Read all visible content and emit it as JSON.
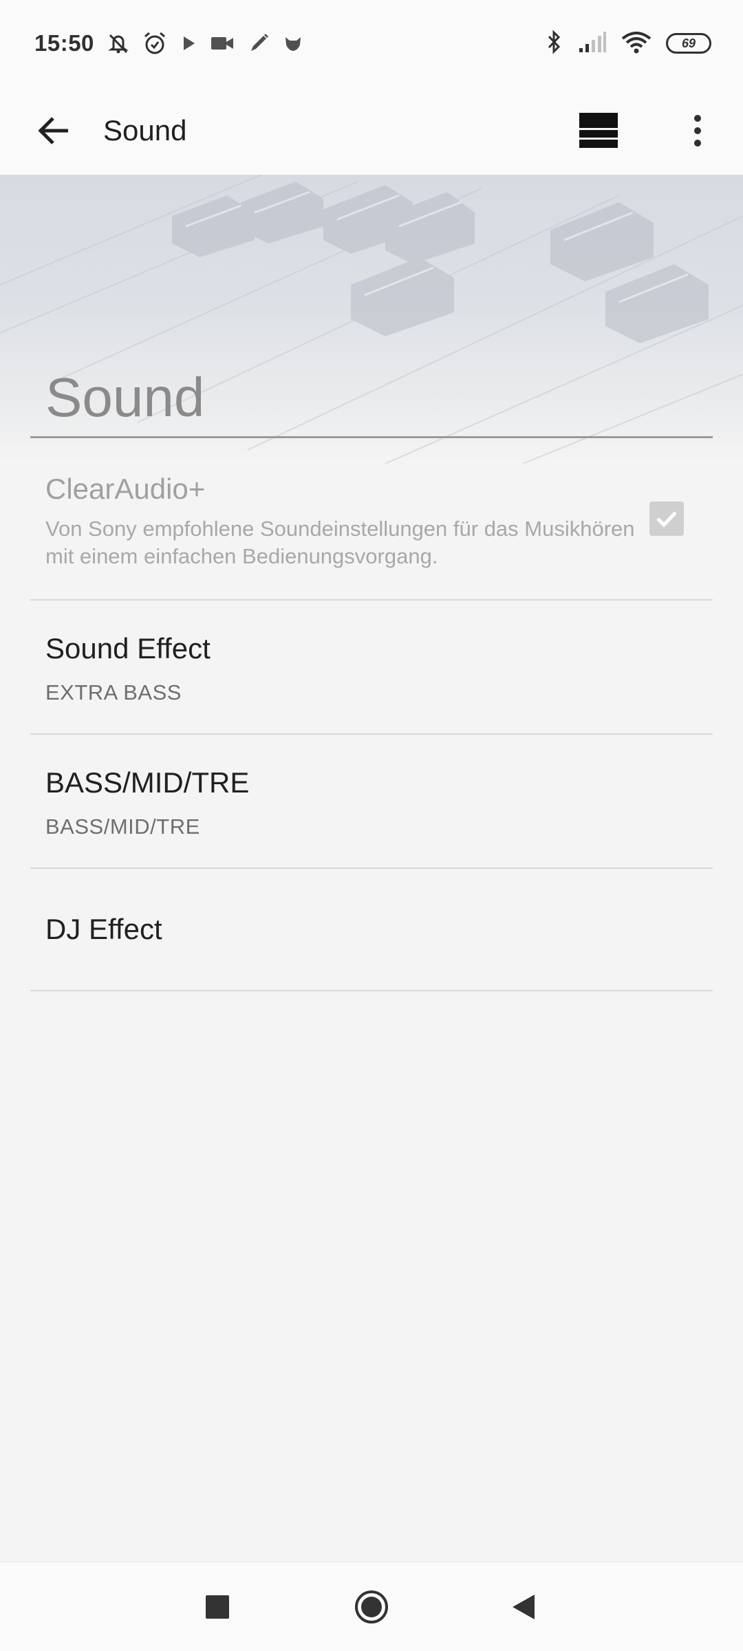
{
  "status_bar": {
    "time": "15:50",
    "battery": "69",
    "icons": [
      "muted-bell-icon",
      "alarm-icon",
      "play-icon",
      "video-camera-icon",
      "pen-icon",
      "fox-icon",
      "bluetooth-icon",
      "signal-icon",
      "wifi-icon",
      "battery-icon"
    ]
  },
  "app_bar": {
    "title": "Sound",
    "icons": [
      "back-arrow-icon",
      "layout-icon",
      "more-vert-icon"
    ]
  },
  "header": {
    "title": "Sound"
  },
  "settings": [
    {
      "label": "ClearAudio+",
      "description": "Von Sony empfohlene Soundeinstellungen für das Musikhören mit einem einfachen Bedienungsvorgang.",
      "checked": true,
      "enabled": false
    },
    {
      "label": "Sound Effect",
      "value": "EXTRA BASS"
    },
    {
      "label": "BASS/MID/TRE",
      "value": "BASS/MID/TRE"
    },
    {
      "label": "DJ Effect"
    }
  ],
  "nav_bar": {
    "icons": [
      "recents-square-icon",
      "home-circle-icon",
      "back-triangle-icon"
    ]
  }
}
